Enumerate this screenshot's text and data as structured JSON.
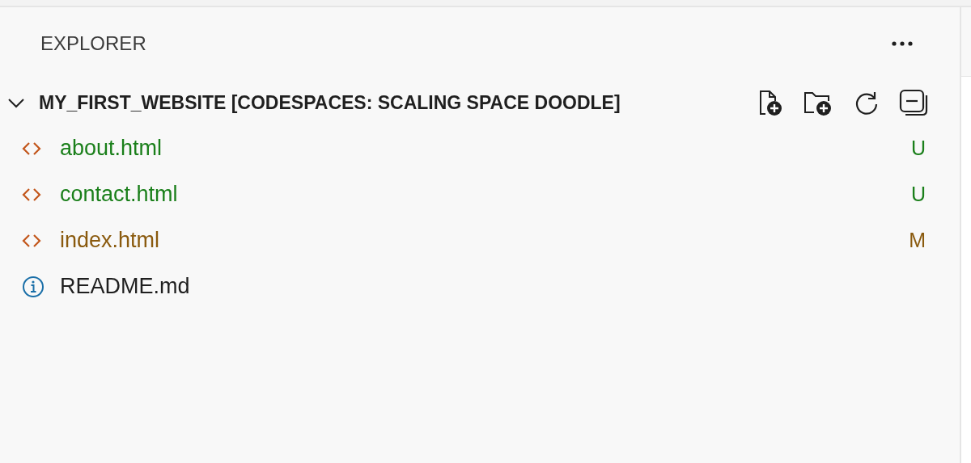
{
  "panel": {
    "title": "EXPLORER"
  },
  "folder": {
    "name": "MY_FIRST_WEBSITE [CODESPACES: SCALING SPACE DOODLE]",
    "expanded": true
  },
  "files": [
    {
      "name": "about.html",
      "kind": "html",
      "status": "U",
      "color": "#1a7f1a"
    },
    {
      "name": "contact.html",
      "kind": "html",
      "status": "U",
      "color": "#1a7f1a"
    },
    {
      "name": "index.html",
      "kind": "html",
      "status": "M",
      "color": "#8a5a0e"
    },
    {
      "name": "README.md",
      "kind": "info"
    }
  ]
}
